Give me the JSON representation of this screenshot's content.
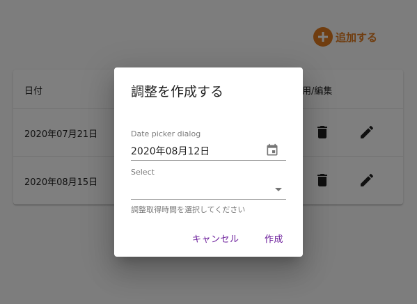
{
  "header": {
    "add_label": "追加する"
  },
  "table": {
    "columns": {
      "date": "日付",
      "actions": "使用/編集"
    },
    "rows": [
      {
        "date": "2020年07月21日"
      },
      {
        "date": "2020年08月15日"
      }
    ]
  },
  "dialog": {
    "title": "調整を作成する",
    "date_label": "Date picker dialog",
    "date_value": "2020年08月12日",
    "select_label": "Select",
    "select_value": "",
    "helper_text": "調整取得時間を選択してください",
    "cancel_label": "キャンセル",
    "create_label": "作成"
  },
  "colors": {
    "accent": "#e07a1f",
    "dialog_button": "#6a1b9a",
    "backdrop": "rgba(0,0,0,0.5)"
  },
  "icons": {
    "add": "add-circle-icon",
    "delete": "trash-icon",
    "edit": "pencil-icon",
    "calendar": "calendar-icon",
    "dropdown": "chevron-down-icon"
  }
}
